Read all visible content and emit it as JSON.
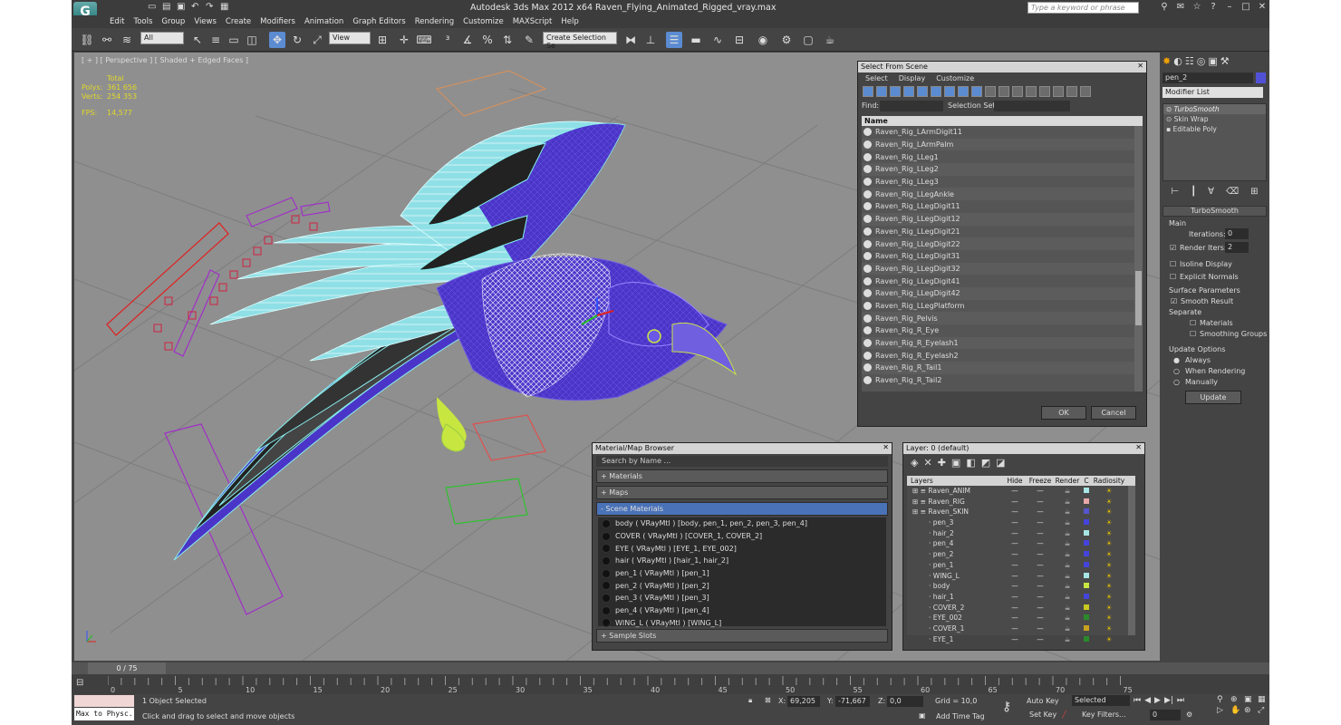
{
  "app": {
    "title": "Autodesk 3ds Max  2012 x64      Raven_Flying_Animated_Rigged_vray.max",
    "search_placeholder": "Type a keyword or phrase",
    "logo": "3ds-max-logo"
  },
  "menu": [
    "Edit",
    "Tools",
    "Group",
    "Views",
    "Create",
    "Modifiers",
    "Animation",
    "Graph Editors",
    "Rendering",
    "Customize",
    "MAXScript",
    "Help"
  ],
  "toolbar": {
    "selection_filter": "All",
    "ref_coord": "View",
    "named_selection": "Create Selection Se"
  },
  "viewport": {
    "label": "[ + ] [ Perspective ] [ Shaded + Edged Faces ]",
    "stats": {
      "header": "Total",
      "polys_label": "Polys:",
      "polys": "361 656",
      "verts_label": "Verts:",
      "verts": "254 353",
      "fps_label": "FPS:",
      "fps": "14,577"
    }
  },
  "select_from_scene": {
    "title": "Select From Scene",
    "menu": [
      "Select",
      "Display",
      "Customize"
    ],
    "find_label": "Find:",
    "selection_set_label": "Selection Set:",
    "column": "Name",
    "items": [
      "Raven_Rig_LArmDigit11",
      "Raven_Rig_LArmPalm",
      "Raven_Rig_LLeg1",
      "Raven_Rig_LLeg2",
      "Raven_Rig_LLeg3",
      "Raven_Rig_LLegAnkle",
      "Raven_Rig_LLegDigit11",
      "Raven_Rig_LLegDigit12",
      "Raven_Rig_LLegDigit21",
      "Raven_Rig_LLegDigit22",
      "Raven_Rig_LLegDigit31",
      "Raven_Rig_LLegDigit32",
      "Raven_Rig_LLegDigit41",
      "Raven_Rig_LLegDigit42",
      "Raven_Rig_LLegPlatform",
      "Raven_Rig_Pelvis",
      "Raven_Rig_R_Eye",
      "Raven_Rig_R_Eyelash1",
      "Raven_Rig_R_Eyelash2",
      "Raven_Rig_R_Tail1",
      "Raven_Rig_R_Tail2"
    ],
    "ok": "OK",
    "cancel": "Cancel"
  },
  "material_browser": {
    "title": "Material/Map Browser",
    "search": "Search by Name ...",
    "groups": {
      "materials": "+ Materials",
      "maps": "+ Maps",
      "scene": "- Scene Materials",
      "sample": "+ Sample Slots"
    },
    "scene_materials": [
      "body  ( VRayMtl ) [body, pen_1, pen_2, pen_3, pen_4]",
      "COVER  ( VRayMtl ) [COVER_1, COVER_2]",
      "EYE  ( VRayMtl ) [EYE_1, EYE_002]",
      "hair  ( VRayMtl ) [hair_1, hair_2]",
      "pen_1  ( VRayMtl ) [pen_1]",
      "pen_2  ( VRayMtl ) [pen_2]",
      "pen_3  ( VRayMtl ) [pen_3]",
      "pen_4  ( VRayMtl ) [pen_4]",
      "WING_L  ( VRayMtl ) [WING_L]"
    ]
  },
  "layer_manager": {
    "title": "Layer: 0 (default)",
    "columns": [
      "Layers",
      "Hide",
      "Freeze",
      "Render",
      "C",
      "Radiosity"
    ],
    "rows": [
      {
        "name": "Raven_ANIM",
        "indent": 0,
        "color": "#a8e6e6"
      },
      {
        "name": "Raven_RIG",
        "indent": 0,
        "color": "#e6a8a8"
      },
      {
        "name": "Raven_SKIN",
        "indent": 0,
        "color": "#5555cc"
      },
      {
        "name": "pen_3",
        "indent": 1,
        "color": "#4444dd"
      },
      {
        "name": "hair_2",
        "indent": 1,
        "color": "#a8e6e6"
      },
      {
        "name": "pen_4",
        "indent": 1,
        "color": "#4444dd"
      },
      {
        "name": "pen_2",
        "indent": 1,
        "color": "#4444dd"
      },
      {
        "name": "pen_1",
        "indent": 1,
        "color": "#4444dd"
      },
      {
        "name": "WING_L",
        "indent": 1,
        "color": "#a8e6e6"
      },
      {
        "name": "body",
        "indent": 1,
        "color": "#c8e640"
      },
      {
        "name": "hair_1",
        "indent": 1,
        "color": "#4444dd"
      },
      {
        "name": "COVER_2",
        "indent": 1,
        "color": "#c8c820"
      },
      {
        "name": "EYE_002",
        "indent": 1,
        "color": "#2a8a2a"
      },
      {
        "name": "COVER_1",
        "indent": 1,
        "color": "#c8a020"
      },
      {
        "name": "EYE_1",
        "indent": 1,
        "color": "#2a8a2a"
      }
    ]
  },
  "command_panel": {
    "object_name": "pen_2",
    "modifier_list": "Modifier List",
    "stack": [
      "TurboSmooth",
      "Skin Wrap",
      "Editable Poly"
    ],
    "rollout_title": "TurboSmooth",
    "main": "Main",
    "iterations_label": "Iterations:",
    "iterations": "0",
    "render_iters_label": "Render Iters:",
    "render_iters": "2",
    "isoline": "Isoline Display",
    "explicit": "Explicit Normals",
    "surface_params": "Surface Parameters",
    "smooth_result": "Smooth Result",
    "separate": "Separate",
    "materials": "Materials",
    "smoothing_groups": "Smoothing Groups",
    "update_options": "Update Options",
    "always": "Always",
    "when_rendering": "When Rendering",
    "manually": "Manually",
    "update": "Update"
  },
  "timeline": {
    "frame": "0 / 75",
    "ticks": [
      "0",
      "5",
      "10",
      "15",
      "20",
      "25",
      "30",
      "35",
      "40",
      "45",
      "50",
      "55",
      "60",
      "65",
      "70",
      "75"
    ]
  },
  "status": {
    "maxscript": "Max to Physc.",
    "selected": "1 Object Selected",
    "prompt": "Click and drag to select and move objects",
    "x_label": "X:",
    "x": "69,205",
    "y_label": "Y:",
    "y": "-71,667",
    "z_label": "Z:",
    "z": "0,0",
    "grid": "Grid = 10,0",
    "add_time_tag": "Add Time Tag",
    "auto_key": "Auto Key",
    "set_key": "Set Key",
    "selected_dd": "Selected",
    "key_filters": "Key Filters...",
    "frame_field": "0"
  }
}
